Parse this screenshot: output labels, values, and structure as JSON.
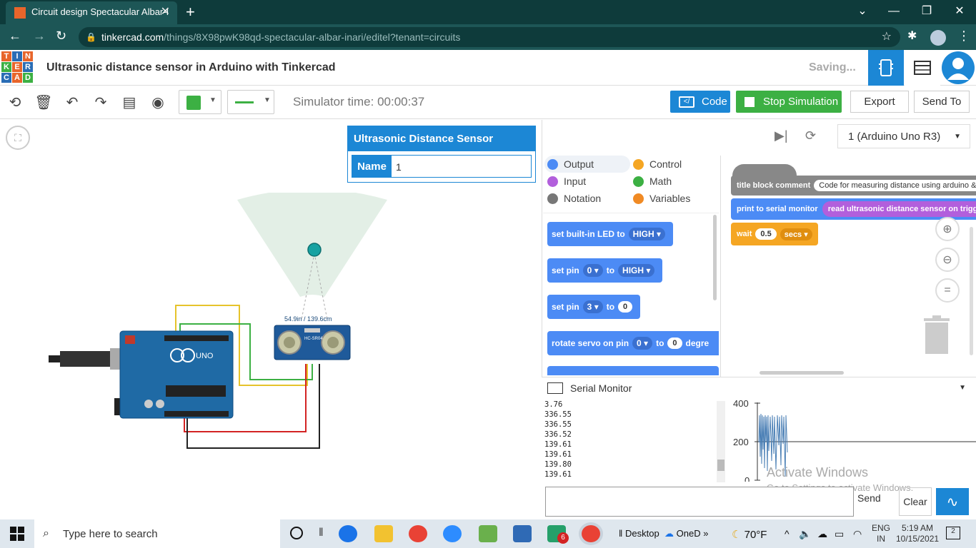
{
  "browser": {
    "tab_title": "Circuit design Spectacular Albar-I",
    "url_host": "tinkercad.com",
    "url_path": "/things/8X98pwK98qd-spectacular-albar-inari/editel?tenant=circuits"
  },
  "app": {
    "logo_letters": [
      "T",
      "I",
      "N",
      "K",
      "E",
      "R",
      "C",
      "A",
      "D"
    ],
    "title": "Ultrasonic distance sensor in Arduino with Tinkercad",
    "saving": "Saving..."
  },
  "toolbar": {
    "sim_time": "Simulator time: 00:00:37",
    "code": "Code",
    "stop": "Stop Simulation",
    "export": "Export",
    "send_to": "Send To"
  },
  "inspector": {
    "title": "Ultrasonic Distance Sensor",
    "name_label": "Name",
    "name_value": "1"
  },
  "canvas": {
    "distance_label": "54.9in / 139.6cm",
    "arduino_label": "UNO",
    "sensor_label": "HC-SR04"
  },
  "code_panel": {
    "board": "1 (Arduino Uno R3)",
    "categories": [
      {
        "label": "Output",
        "color": "#4c8bf5"
      },
      {
        "label": "Control",
        "color": "#f5a623"
      },
      {
        "label": "Input",
        "color": "#b25fdc"
      },
      {
        "label": "Math",
        "color": "#3cb043"
      },
      {
        "label": "Notation",
        "color": "#777777"
      },
      {
        "label": "Variables",
        "color": "#f08a24"
      }
    ],
    "blocks": {
      "b1_text": "set built-in LED to",
      "b1_val": "HIGH",
      "b2_text": "set pin",
      "b2_pin": "0",
      "b2_to": "to",
      "b2_val": "HIGH",
      "b3_text": "set pin",
      "b3_pin": "3",
      "b3_to": "to",
      "b3_val": "0",
      "b4_text": "rotate servo on pin",
      "b4_pin": "0",
      "b4_to": "to",
      "b4_val": "0",
      "b4_tail": "degre"
    },
    "workspace": {
      "comment_label": "title block comment",
      "comment_text": "Code for measuring distance using arduino &",
      "print_label": "print to serial monitor",
      "print_arg": "read ultrasonic distance sensor on trigger pi",
      "wait_label": "wait",
      "wait_value": "0.5",
      "wait_unit": "secs"
    }
  },
  "serial": {
    "title": "Serial Monitor",
    "lines": [
      "3.76",
      "336.55",
      "336.55",
      "336.52",
      "139.61",
      "139.61",
      "139.80",
      "139.61"
    ],
    "send": "Send",
    "clear": "Clear",
    "plot_ticks": [
      "400",
      "200",
      "0"
    ]
  },
  "watermark": {
    "line1": "Activate Windows",
    "line2": "Go to Settings to activate Windows."
  },
  "taskbar": {
    "search": "Type here to search",
    "desktop": "Desktop",
    "onedrive": "OneD",
    "weather": "70°F",
    "lang1": "ENG",
    "lang2": "IN",
    "time": "5:19 AM",
    "date": "10/15/2021",
    "notif_count": "2",
    "badge": "6"
  }
}
